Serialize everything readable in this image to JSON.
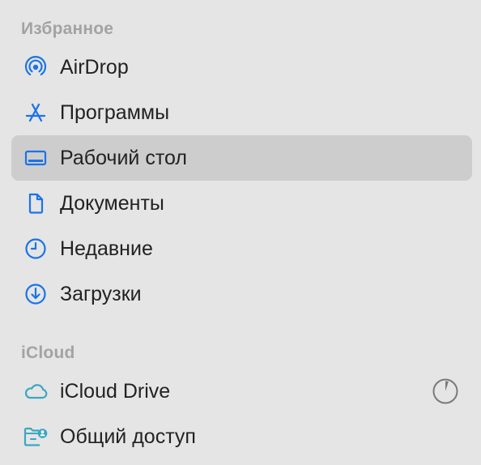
{
  "sections": {
    "favorites": {
      "header": "Избранное",
      "items": [
        {
          "label": "AirDrop",
          "icon": "airdrop-icon"
        },
        {
          "label": "Программы",
          "icon": "applications-icon"
        },
        {
          "label": "Рабочий стол",
          "icon": "desktop-icon",
          "selected": true
        },
        {
          "label": "Документы",
          "icon": "document-icon"
        },
        {
          "label": "Недавние",
          "icon": "clock-icon"
        },
        {
          "label": "Загрузки",
          "icon": "download-icon"
        }
      ]
    },
    "icloud": {
      "header": "iCloud",
      "items": [
        {
          "label": "iCloud Drive",
          "icon": "cloud-icon",
          "sync_progress": 0.05
        },
        {
          "label": "Общий доступ",
          "icon": "shared-folder-icon"
        }
      ]
    }
  },
  "colors": {
    "accent": "#1a73e8",
    "icloud_accent": "#3aa7c2",
    "selection": "#cdcdcd",
    "background": "#e5e5e5",
    "header": "#a3a3a3",
    "text": "#222222"
  }
}
